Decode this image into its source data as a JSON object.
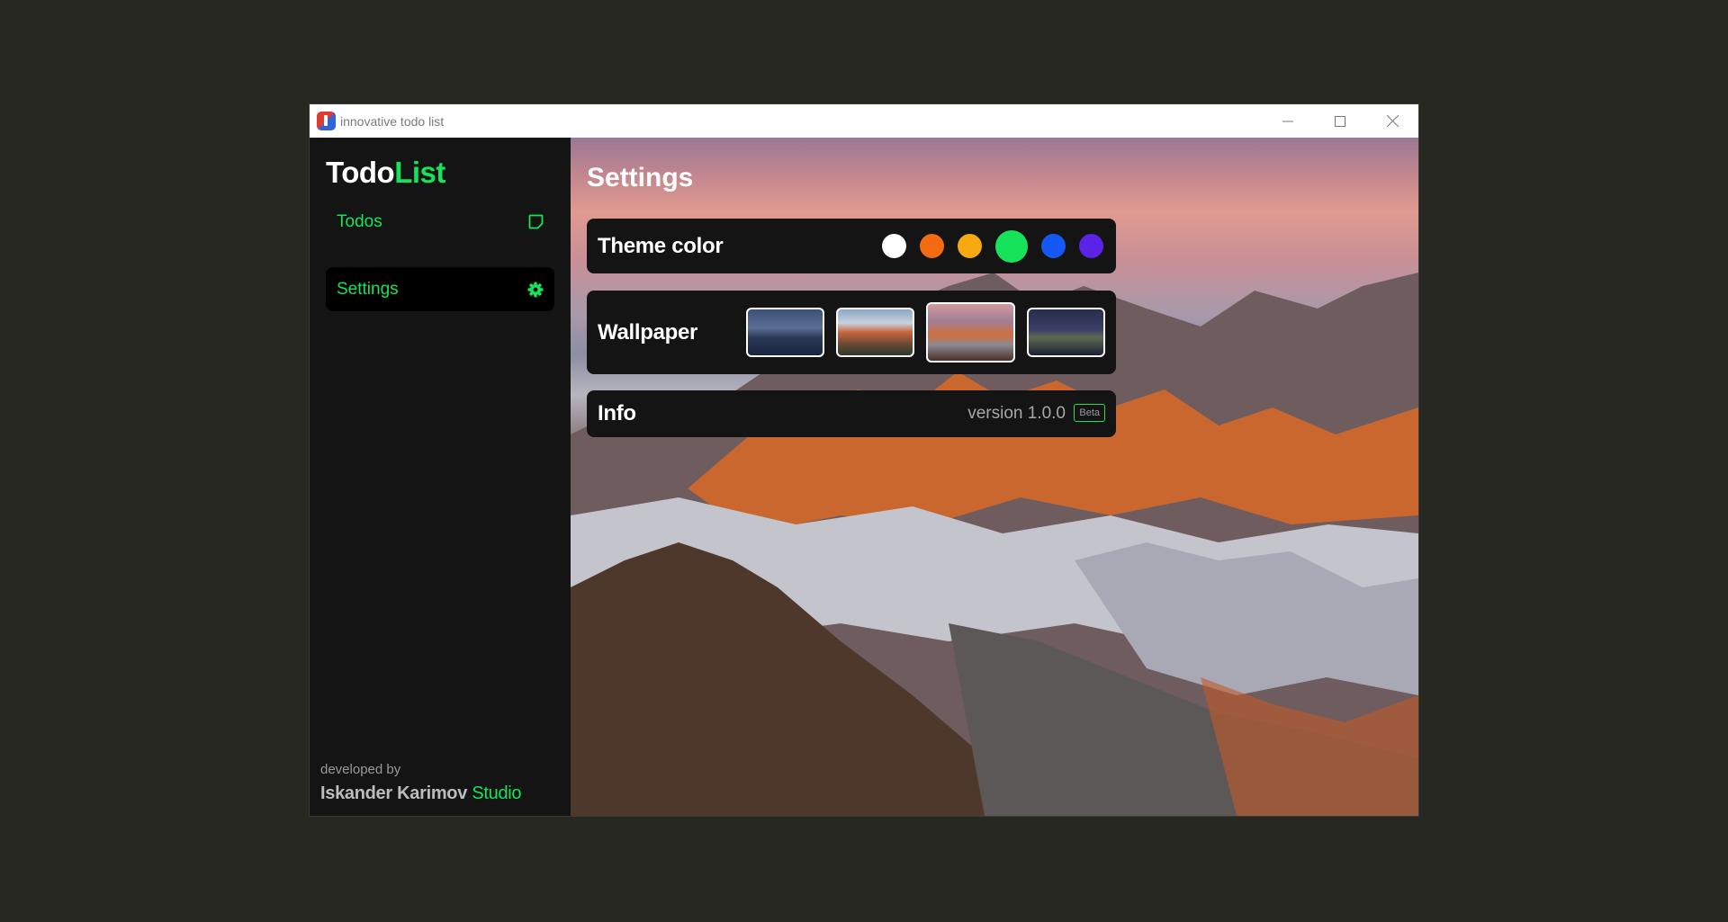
{
  "window": {
    "title": "innovative todo list"
  },
  "sidebar": {
    "logo_part1": "Todo",
    "logo_part2": "List",
    "items": [
      {
        "label": "Todos",
        "icon": "note-square-icon"
      },
      {
        "label": "Settings",
        "icon": "gear-icon",
        "selected": true
      }
    ],
    "footer": {
      "developed_by": "developed by",
      "developer_name": "Iskander Karimov",
      "studio": "Studio"
    }
  },
  "main": {
    "title": "Settings",
    "theme": {
      "title": "Theme color",
      "colors": [
        "#ffffff",
        "#f26b10",
        "#f7aa0f",
        "#16e35a",
        "#1459f5",
        "#5b23e6"
      ],
      "selected_color": "#16e35a"
    },
    "wallpaper": {
      "title": "Wallpaper",
      "options": [
        "mojave-night",
        "el-capitan",
        "sierra",
        "catalina"
      ],
      "selected": "sierra"
    },
    "info": {
      "title": "Info",
      "version": "version 1.0.0",
      "badge": "Beta"
    }
  },
  "colors": {
    "accent": "#16e35a",
    "panel": "#141414",
    "background": "#272822"
  }
}
